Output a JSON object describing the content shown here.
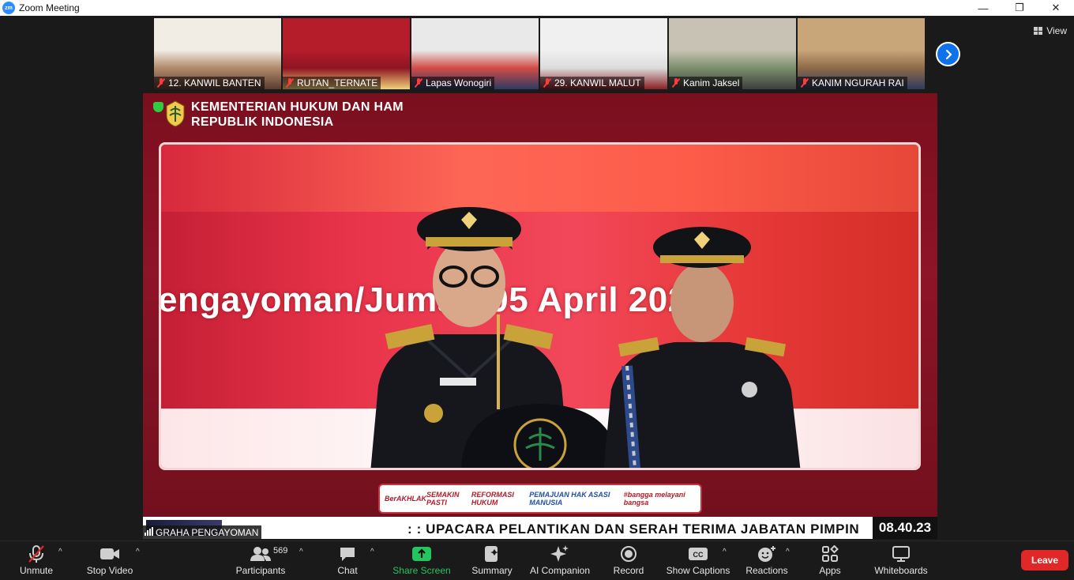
{
  "window": {
    "title": "Zoom Meeting",
    "app_icon_text": "zm",
    "controls": [
      "—",
      "❐",
      "✕"
    ]
  },
  "view_button": {
    "label": "View"
  },
  "participants_strip": [
    {
      "name": "12. KANWIL BANTEN",
      "muted": true,
      "colors": [
        "#f1ece4",
        "#b08a6a",
        "#5c3b2e"
      ]
    },
    {
      "name": "RUTAN_TERNATE",
      "muted": true,
      "colors": [
        "#b51d2a",
        "#8e1422",
        "#f0d27a"
      ]
    },
    {
      "name": "Lapas Wonogiri",
      "muted": true,
      "colors": [
        "#e9e9ea",
        "#d34b46",
        "#2b3b63"
      ]
    },
    {
      "name": "29. KANWIL MALUT",
      "muted": true,
      "colors": [
        "#f0f0f0",
        "#dcdcdc",
        "#8a1e24"
      ]
    },
    {
      "name": "Kanim Jaksel",
      "muted": true,
      "colors": [
        "#c8c2b4",
        "#7c8f6d",
        "#3d3d3d"
      ]
    },
    {
      "name": "KANIM NGURAH RAI",
      "muted": true,
      "colors": [
        "#c9a57a",
        "#8e6b49",
        "#2e3a5c"
      ]
    }
  ],
  "main_video": {
    "ministry_line1": "KEMENTERIAN HUKUM DAN HAM",
    "ministry_line2": "REPUBLIK INDONESIA",
    "screen_text": "engayoman/Jumat, 05 April 2024",
    "banner_items": [
      "BerAKHLAK",
      "SEMAKIN PASTI",
      "REFORMASI HUKUM",
      "PEMAJUAN HAK ASASI MANUSIA",
      "#bangga melayani bangsa"
    ],
    "room_name": "GRAHA PENGAYOMAN",
    "ticker_text": ": :  UPACARA PELANTIKAN  DAN SERAH TERIMA JABATAN PIMPIN",
    "clock": "08.40.23"
  },
  "toolbar": {
    "unmute": "Unmute",
    "stop_video": "Stop Video",
    "participants": "Participants",
    "participants_count": "569",
    "chat": "Chat",
    "share_screen": "Share Screen",
    "summary": "Summary",
    "ai_companion": "AI Companion",
    "record": "Record",
    "show_captions": "Show Captions",
    "reactions": "Reactions",
    "apps": "Apps",
    "whiteboards": "Whiteboards",
    "leave": "Leave",
    "caret": "^"
  }
}
